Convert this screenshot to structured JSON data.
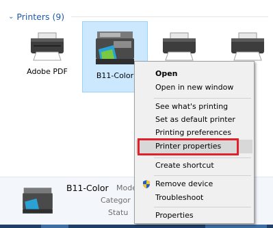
{
  "group": {
    "chevron": "⌄",
    "title": "Printers (9)"
  },
  "tiles": [
    {
      "label": "Adobe PDF",
      "icon": "printer-icon"
    },
    {
      "label": "B11-Color",
      "icon": "multifunction-printer-icon"
    },
    {
      "label": "",
      "icon": "printer-icon"
    },
    {
      "label": "",
      "icon": "printer-icon"
    }
  ],
  "details": {
    "name": "B11-Color",
    "model_label": "Mode",
    "category_label": "Categor",
    "status_label": "Statu"
  },
  "menu": {
    "open": "Open",
    "open_new_window": "Open in new window",
    "see_printing": "See what's printing",
    "set_default": "Set as default printer",
    "printing_prefs": "Printing preferences",
    "printer_props": "Printer properties",
    "create_shortcut": "Create shortcut",
    "remove_device": "Remove device",
    "troubleshoot": "Troubleshoot",
    "properties": "Properties"
  },
  "colors": {
    "highlight": "#e0202a",
    "selection_bg": "#cce8ff",
    "group_title": "#1e5aa8"
  }
}
